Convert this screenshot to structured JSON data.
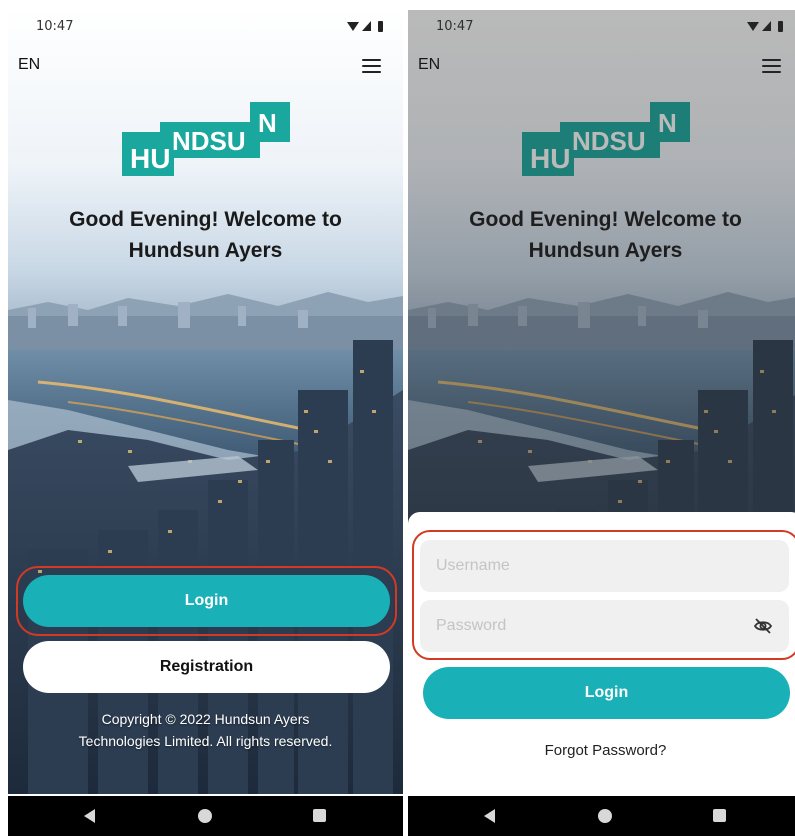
{
  "status_bar": {
    "time": "10:47"
  },
  "app_bar": {
    "language": "EN",
    "menu_icon": "hamburger-menu-icon"
  },
  "logo": {
    "text": "HUNDSUN",
    "color": "#19a79e"
  },
  "greeting": {
    "line1": "Good Evening!  Welcome to",
    "line2": "Hundsun Ayers"
  },
  "landing": {
    "login_label": "Login",
    "registration_label": "Registration",
    "copyright_line1": "Copyright © 2022 Hundsun Ayers",
    "copyright_line2": "Technologies Limited. All rights reserved."
  },
  "login_sheet": {
    "username_placeholder": "Username",
    "password_placeholder": "Password",
    "password_visibility_icon": "eye-off-icon",
    "login_label": "Login",
    "forgot_password": "Forgot Password?"
  },
  "nav_bar": {
    "icons": [
      "back-icon",
      "home-icon",
      "recent-apps-icon"
    ]
  },
  "colors": {
    "accent": "#19b0b8",
    "highlight": "#d23a24"
  }
}
